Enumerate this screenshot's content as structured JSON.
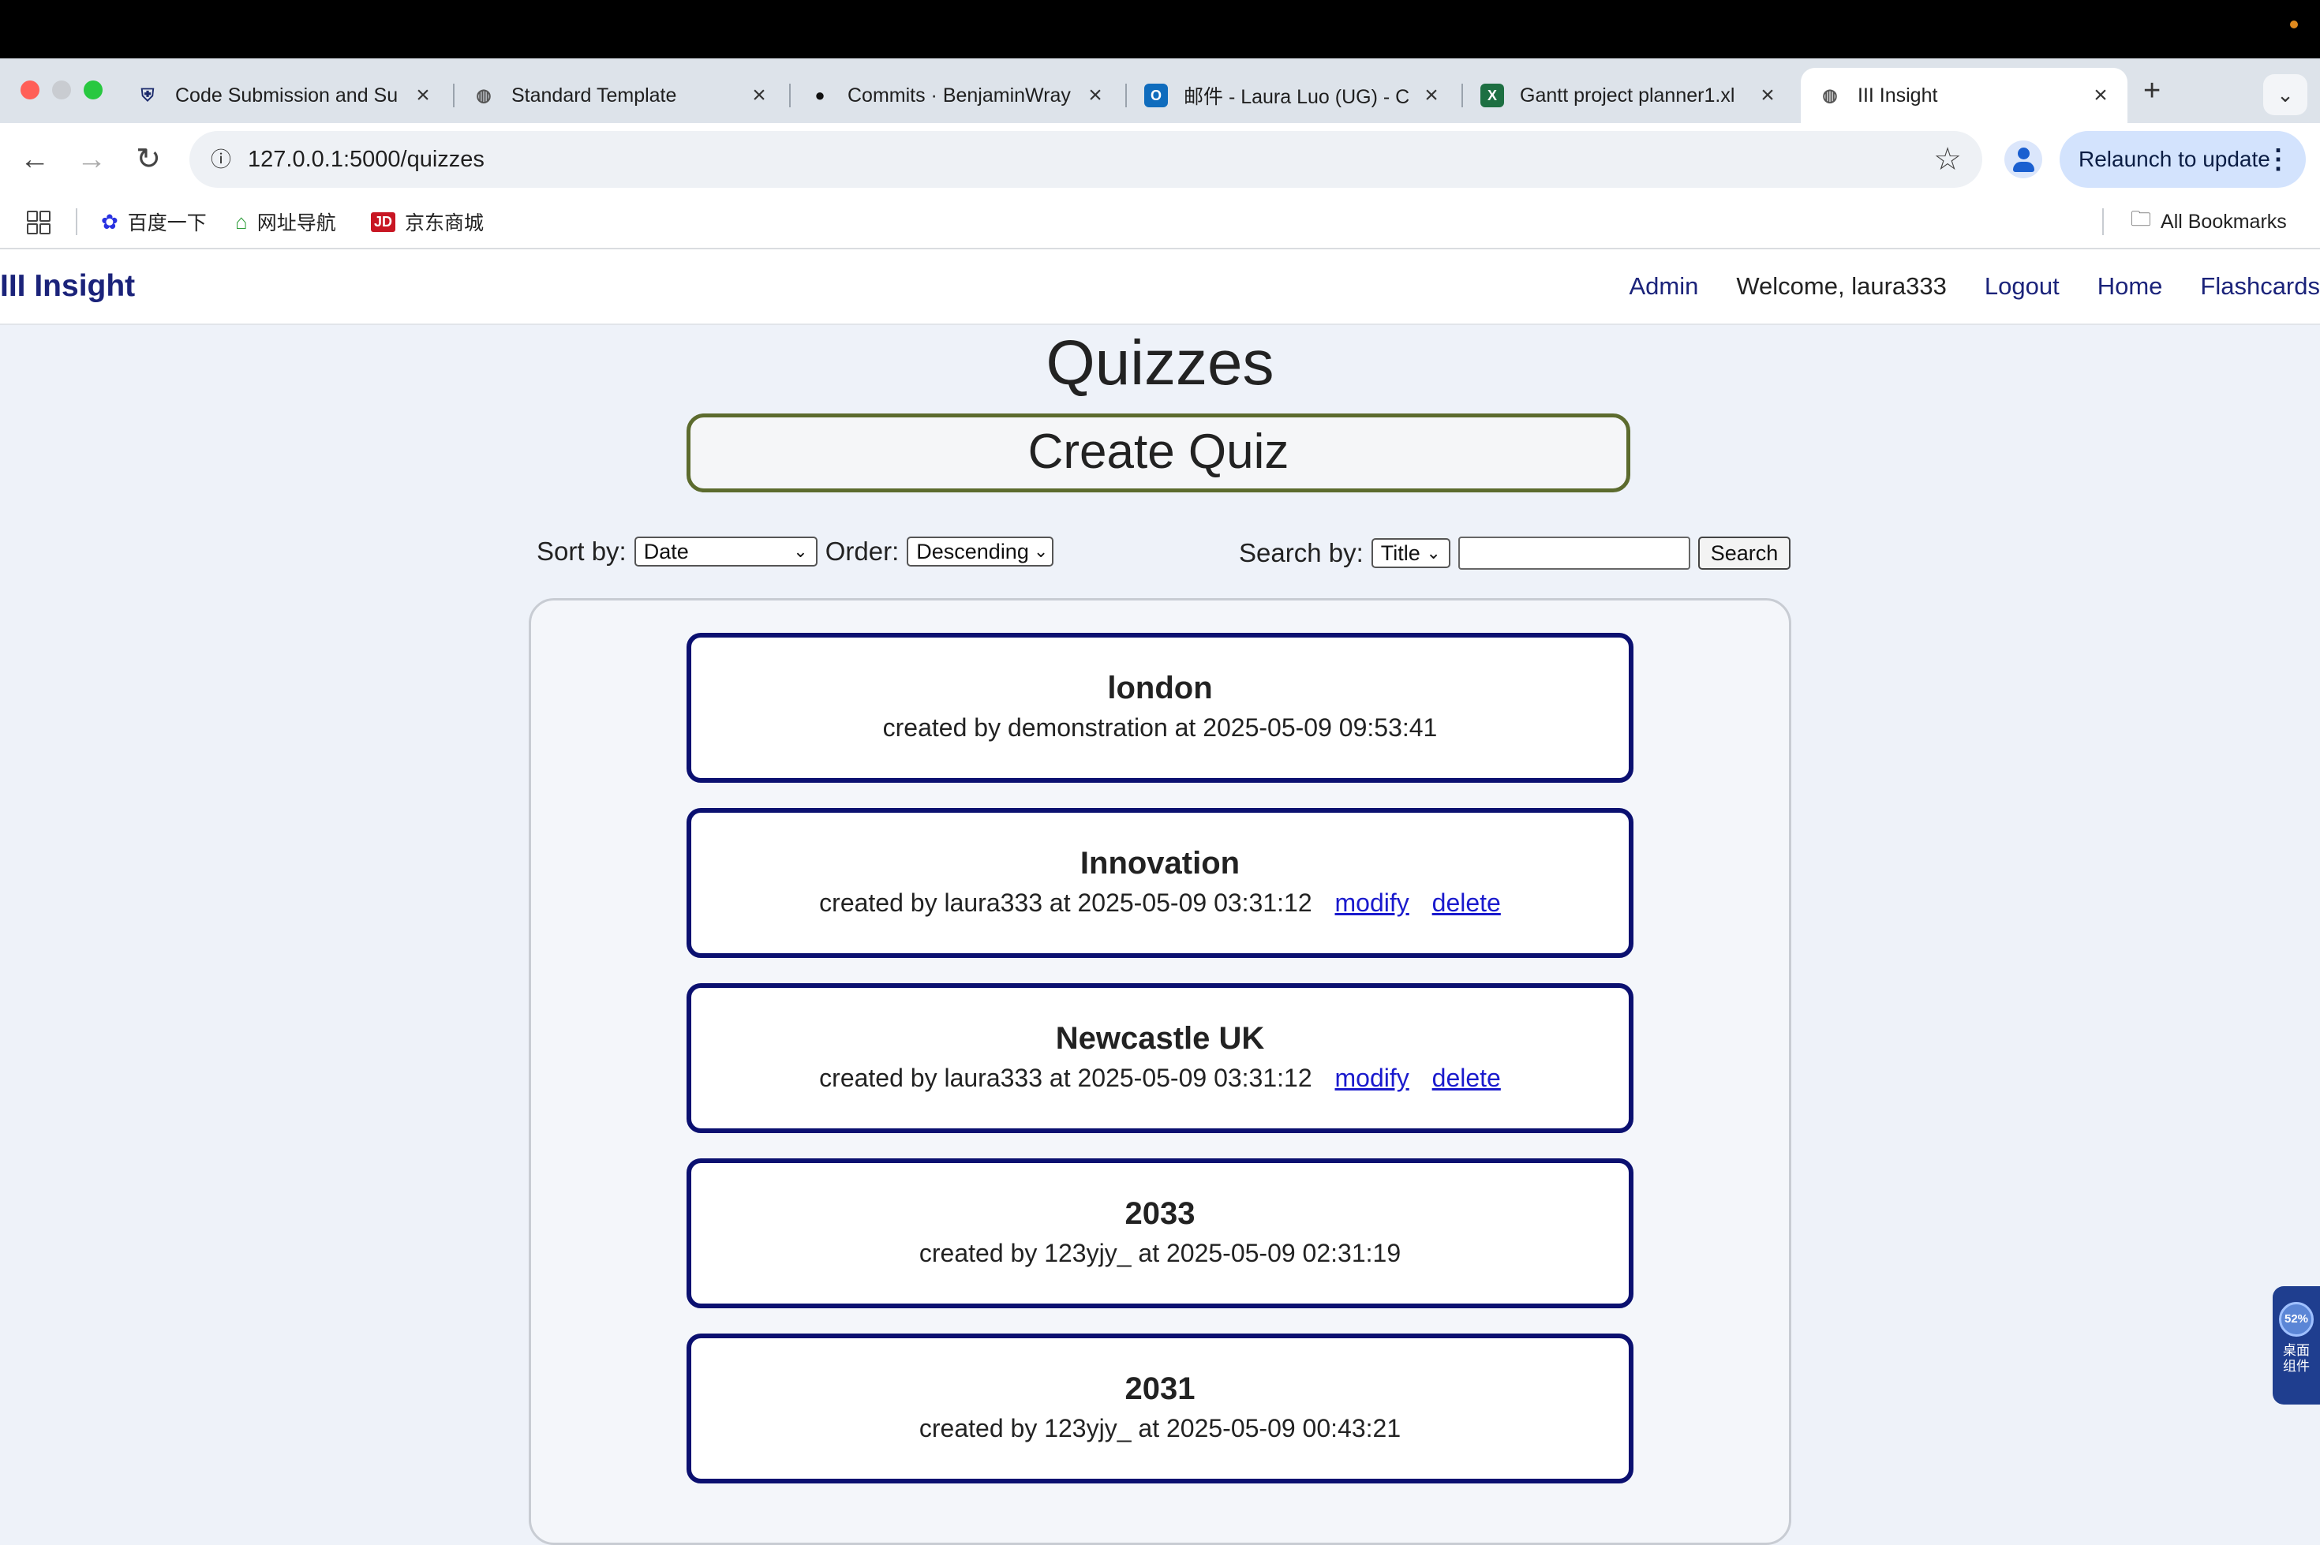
{
  "browser": {
    "tabs": [
      {
        "title": "Code Submission and Su",
        "active": false
      },
      {
        "title": "Standard Template",
        "active": false
      },
      {
        "title": "Commits · BenjaminWray",
        "active": false
      },
      {
        "title": "邮件 - Laura Luo (UG) - C",
        "active": false
      },
      {
        "title": "Gantt project planner1.xl",
        "active": false
      },
      {
        "title": "III Insight",
        "active": true
      }
    ],
    "new_tab": "+",
    "url": "127.0.0.1:5000/quizzes",
    "relaunch_label": "Relaunch to update",
    "bookmarks": [
      {
        "label": "百度一下",
        "icon": "baidu-icon"
      },
      {
        "label": "网址导航",
        "icon": "hao123-icon"
      },
      {
        "label": "京东商城",
        "icon": "jd-icon"
      }
    ],
    "all_bookmarks": "All Bookmarks"
  },
  "site": {
    "brand": "III Insight",
    "nav": {
      "admin": "Admin",
      "welcome": "Welcome, laura333",
      "logout": "Logout",
      "home": "Home",
      "flashcards": "Flashcards"
    }
  },
  "page": {
    "title": "Quizzes",
    "create_button": "Create Quiz",
    "sort_label": "Sort by:",
    "sort_value": "Date",
    "order_label": "Order:",
    "order_value": "Descending",
    "search_label": "Search by:",
    "search_field_value": "Title",
    "search_query": "",
    "search_button": "Search"
  },
  "quizzes": [
    {
      "title": "london",
      "meta": "created by demonstration at 2025-05-09 09:53:41",
      "modify": "",
      "delete": ""
    },
    {
      "title": "Innovation",
      "meta": "created by laura333 at 2025-05-09 03:31:12",
      "modify": "modify",
      "delete": "delete"
    },
    {
      "title": "Newcastle UK",
      "meta": "created by laura333 at 2025-05-09 03:31:12",
      "modify": "modify",
      "delete": "delete"
    },
    {
      "title": "2033",
      "meta": "created by 123yjy_ at 2025-05-09 02:31:19",
      "modify": "",
      "delete": ""
    },
    {
      "title": "2031",
      "meta": "created by 123yjy_ at 2025-05-09 00:43:21",
      "modify": "",
      "delete": ""
    }
  ],
  "widget": {
    "percent": "52%",
    "label": "桌面组件"
  },
  "colors": {
    "brand": "#1b237a",
    "card_border": "#0b1070",
    "create_border": "#5c6b2e",
    "link": "#1a1acd",
    "background": "#eef2f9"
  }
}
